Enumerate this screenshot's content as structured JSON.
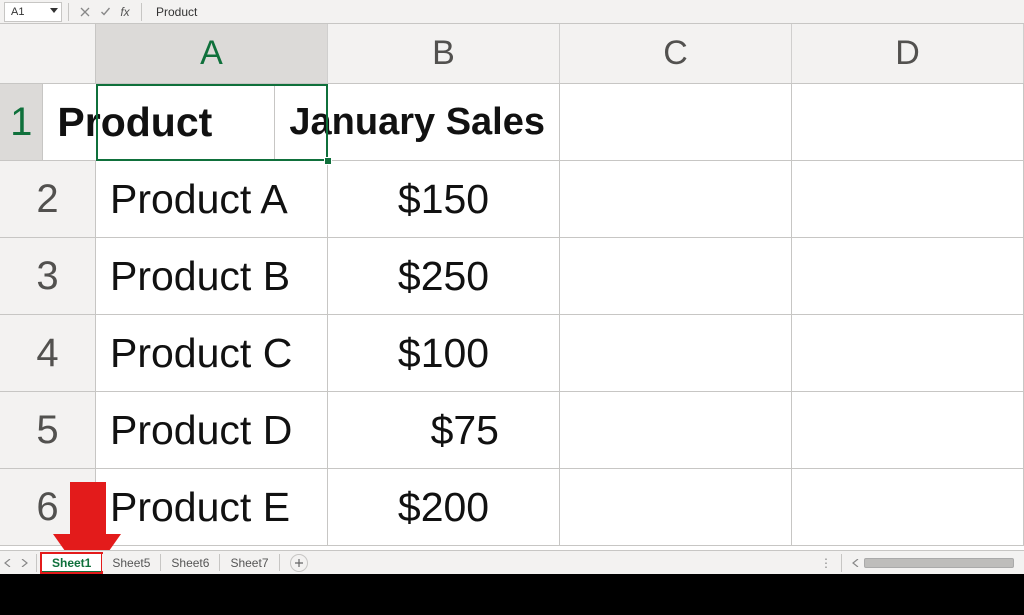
{
  "formula_bar": {
    "name_box": "A1",
    "fx_label": "fx",
    "formula": "Product"
  },
  "columns": [
    "A",
    "B",
    "C",
    "D"
  ],
  "rows": [
    {
      "num": "1",
      "a": "Product",
      "b": "January Sales"
    },
    {
      "num": "2",
      "a": "Product A",
      "b": "$150"
    },
    {
      "num": "3",
      "a": "Product B",
      "b": "$250"
    },
    {
      "num": "4",
      "a": "Product C",
      "b": "$100"
    },
    {
      "num": "5",
      "a": "Product D",
      "b": "$75"
    },
    {
      "num": "6",
      "a": "Product E",
      "b": "$200"
    }
  ],
  "tabs": {
    "active": "Sheet1",
    "items": [
      "Sheet1",
      "Sheet5",
      "Sheet6",
      "Sheet7"
    ]
  },
  "selection": {
    "cell": "A1"
  },
  "chart_data": {
    "type": "table",
    "columns": [
      "Product",
      "January Sales"
    ],
    "rows": [
      [
        "Product A",
        150
      ],
      [
        "Product B",
        250
      ],
      [
        "Product C",
        100
      ],
      [
        "Product D",
        75
      ],
      [
        "Product E",
        200
      ]
    ],
    "currency": "$"
  }
}
